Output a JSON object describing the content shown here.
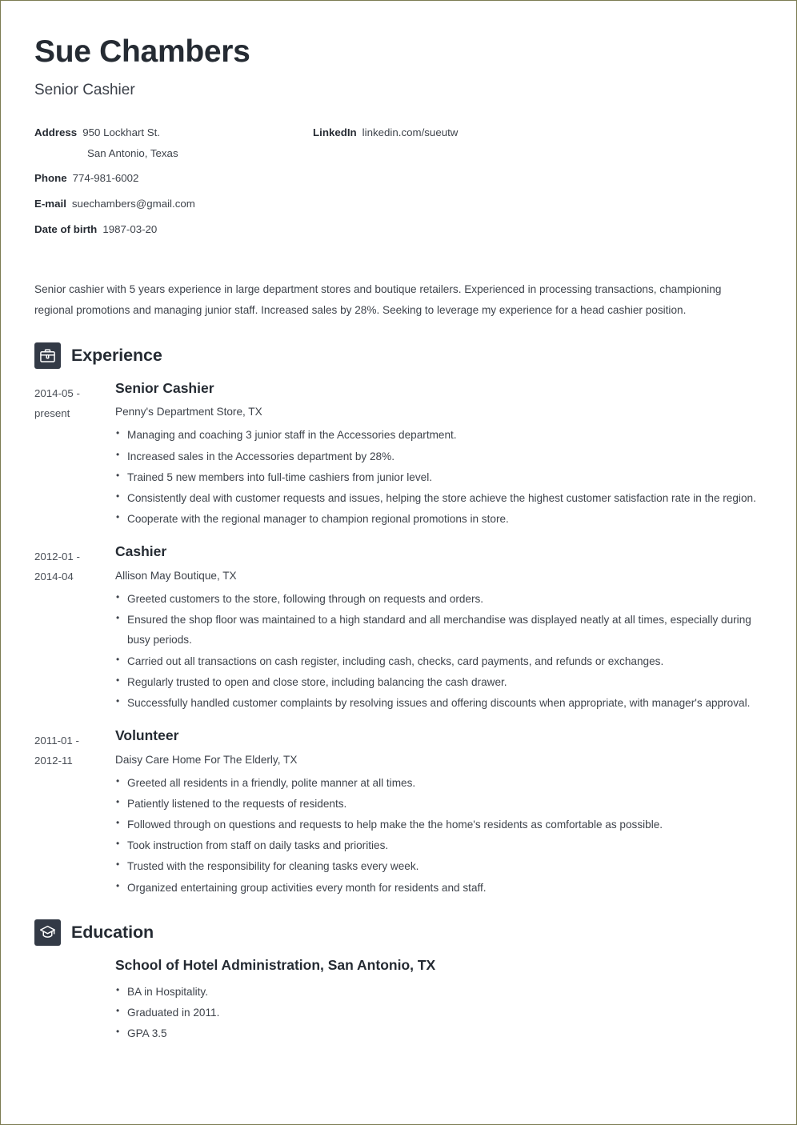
{
  "header": {
    "name": "Sue Chambers",
    "job_title": "Senior Cashier"
  },
  "contact": {
    "left": [
      {
        "label": "Address",
        "value": "950 Lockhart St.",
        "sub": "San Antonio, Texas"
      },
      {
        "label": "Phone",
        "value": "774-981-6002"
      },
      {
        "label": "E-mail",
        "value": "suechambers@gmail.com"
      },
      {
        "label": "Date of birth",
        "value": "1987-03-20"
      }
    ],
    "right": [
      {
        "label": "LinkedIn",
        "value": "linkedin.com/sueutw"
      }
    ]
  },
  "summary": "Senior cashier with 5 years experience in large department stores and boutique retailers. Experienced in processing transactions, championing regional promotions and managing junior staff. Increased sales by 28%. Seeking to leverage my experience for a head cashier position.",
  "sections": [
    {
      "title": "Experience",
      "icon": "briefcase-icon",
      "entries": [
        {
          "date_start": "2014-05 -",
          "date_end": "present",
          "title": "Senior Cashier",
          "org": "Penny's Department Store, TX",
          "bullets": [
            "Managing and coaching 3 junior staff in the Accessories department.",
            "Increased sales in the Accessories department by 28%.",
            "Trained 5 new members into full-time cashiers from junior level.",
            "Consistently deal with customer requests and issues, helping the store achieve the highest customer satisfaction rate in the region.",
            "Cooperate with the regional manager to champion regional promotions in store."
          ]
        },
        {
          "date_start": "2012-01 -",
          "date_end": "2014-04",
          "title": "Cashier",
          "org": "Allison May Boutique, TX",
          "bullets": [
            "Greeted customers to the store, following through on requests and orders.",
            "Ensured the shop floor was maintained to a high standard and all merchandise was displayed neatly at all times, especially during busy periods.",
            "Carried out all transactions on cash register, including cash, checks, card payments, and refunds or exchanges.",
            "Regularly trusted to open and close store, including balancing the cash drawer.",
            "Successfully handled customer complaints by resolving issues and offering discounts when appropriate, with manager's approval."
          ]
        },
        {
          "date_start": "2011-01 -",
          "date_end": "2012-11",
          "title": "Volunteer",
          "org": "Daisy Care Home For The Elderly, TX",
          "bullets": [
            "Greeted all residents in a friendly, polite manner at all times.",
            "Patiently listened to the requests of residents.",
            "Followed through on questions and requests to help make the the home's residents as comfortable as possible.",
            "Took instruction from staff on daily tasks and priorities.",
            "Trusted with the responsibility for cleaning tasks every week.",
            "Organized entertaining group activities every month for residents and staff."
          ]
        }
      ]
    },
    {
      "title": "Education",
      "icon": "graduation-cap-icon",
      "entries": [
        {
          "date_start": "",
          "date_end": "",
          "title": "School of Hotel Administration, San Antonio, TX",
          "org": "",
          "bullets": [
            "BA in Hospitality.",
            "Graduated in 2011.",
            "GPA 3.5"
          ]
        }
      ]
    }
  ],
  "colors": {
    "page_border": "#7b7b52",
    "heading_text": "#252b33",
    "body_text": "#3e434b",
    "icon_background": "#333a46"
  }
}
